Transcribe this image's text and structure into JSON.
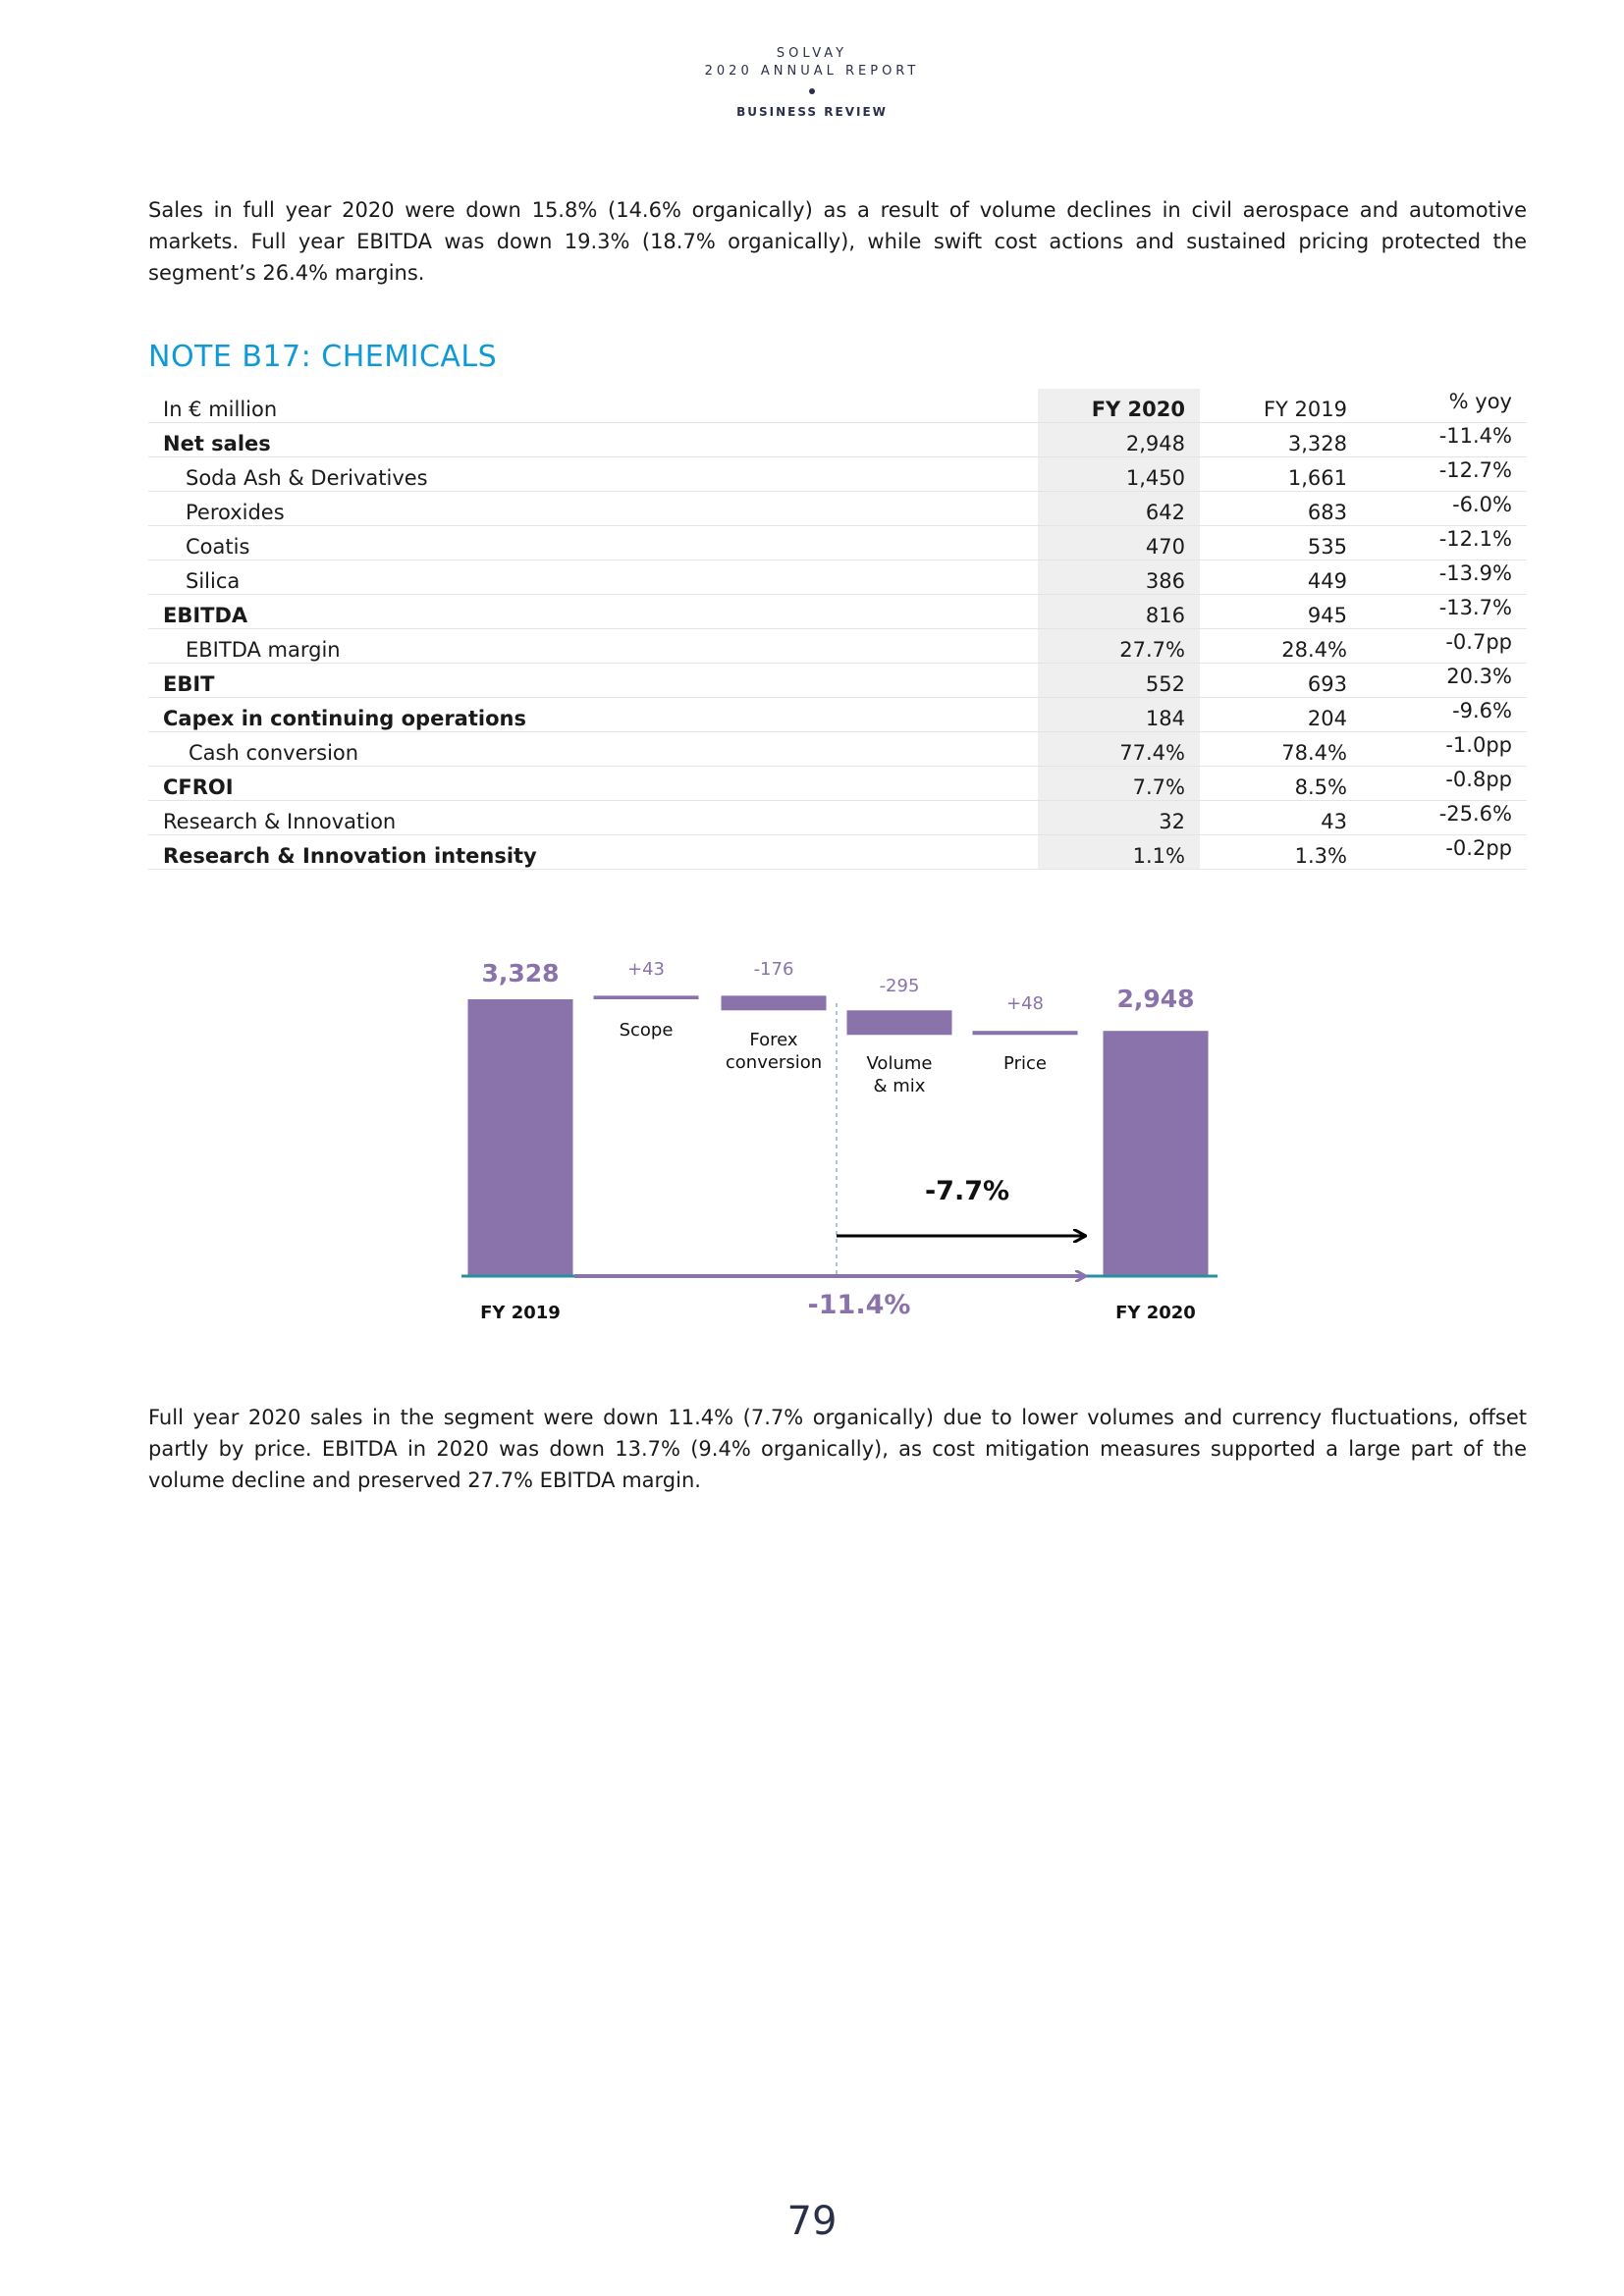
{
  "header": {
    "company": "SOLVAY",
    "report": "2020 ANNUAL REPORT",
    "section": "BUSINESS REVIEW"
  },
  "paragraph_top": "Sales in full year 2020 were down 15.8% (14.6% organically) as a result of volume declines in civil aerospace and automotive markets. Full year EBITDA was down 19.3% (18.7% organically), while swift cost actions and sustained pricing protected the segment’s 26.4% margins.",
  "note_title": "NOTE B17: CHEMICALS",
  "table": {
    "header": {
      "label": "In € million",
      "fy2020": "FY 2020",
      "fy2019": "FY 2019",
      "yoy": "% yoy"
    },
    "rows": [
      {
        "label": "Net sales",
        "fy2020": "2,948",
        "fy2019": "3,328",
        "yoy": "-11.4%"
      },
      {
        "label": "Soda Ash & Derivatives",
        "fy2020": "1,450",
        "fy2019": "1,661",
        "yoy": "-12.7%"
      },
      {
        "label": "Peroxides",
        "fy2020": "642",
        "fy2019": "683",
        "yoy": "-6.0%"
      },
      {
        "label": "Coatis",
        "fy2020": "470",
        "fy2019": "535",
        "yoy": "-12.1%"
      },
      {
        "label": "Silica",
        "fy2020": "386",
        "fy2019": "449",
        "yoy": "-13.9%"
      },
      {
        "label": "EBITDA",
        "fy2020": "816",
        "fy2019": "945",
        "yoy": "-13.7%"
      },
      {
        "label": "EBITDA margin",
        "fy2020": "27.7%",
        "fy2019": "28.4%",
        "yoy": "-0.7pp"
      },
      {
        "label": "EBIT",
        "fy2020": "552",
        "fy2019": "693",
        "yoy": "20.3%"
      },
      {
        "label": "Capex in continuing operations",
        "fy2020": "184",
        "fy2019": "204",
        "yoy": "-9.6%"
      },
      {
        "label": "Cash conversion",
        "fy2020": "77.4%",
        "fy2019": "78.4%",
        "yoy": "-1.0pp"
      },
      {
        "label": "CFROI",
        "fy2020": "7.7%",
        "fy2019": "8.5%",
        "yoy": "-0.8pp"
      },
      {
        "label": "Research & Innovation",
        "fy2020": "32",
        "fy2019": "43",
        "yoy": "-25.6%"
      },
      {
        "label": "Research & Innovation intensity",
        "fy2020": "1.1%",
        "fy2019": "1.3%",
        "yoy": "-0.2pp"
      }
    ]
  },
  "chart_data": {
    "type": "bar",
    "subtype": "waterfall",
    "categories": [
      "FY 2019",
      "Scope",
      "Forex conversion",
      "Volume & mix",
      "Price",
      "FY 2020"
    ],
    "values": [
      3328,
      43,
      -176,
      -295,
      48,
      2948
    ],
    "value_labels": [
      "3,328",
      "+43",
      "-176",
      "-295",
      "+48",
      "2,948"
    ],
    "category_labels": [
      "FY 2019",
      "Scope",
      "Forex\nconversion",
      "Volume\n& mix",
      "Price",
      "FY 2020"
    ],
    "annotations": {
      "organic": "-7.7%",
      "total": "-11.4%"
    },
    "colors": {
      "bar": "#8a72ab",
      "label": "#8a72ab",
      "baseline": "#2a8ea0",
      "dashed": "#8fb0d8",
      "arrow_dark": "#000000"
    }
  },
  "paragraph_bottom": "Full year 2020 sales in the segment were down 11.4% (7.7% organically) due to lower volumes and currency fluctuations, offset partly by price. EBITDA in 2020 was down 13.7% (9.4% organically), as cost mitigation measures supported a large part of the volume decline and preserved 27.7% EBITDA margin.",
  "page_number": "79"
}
